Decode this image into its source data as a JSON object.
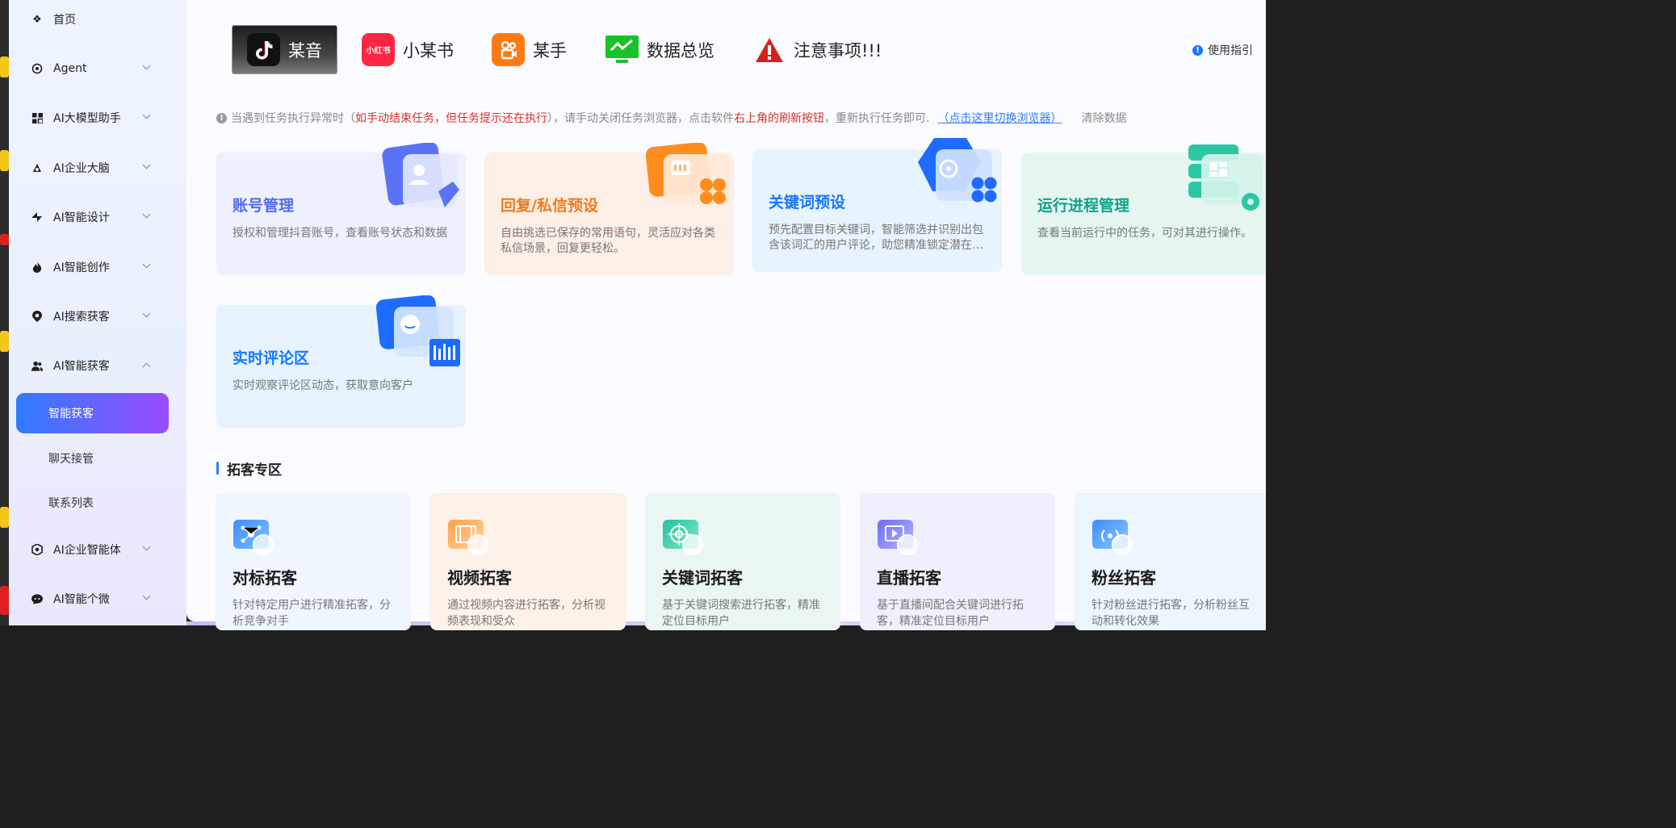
{
  "sidebar": {
    "items": [
      {
        "label": "首页",
        "icon": "home-icon",
        "chevron": "none"
      },
      {
        "label": "Agent",
        "icon": "agent-icon",
        "chevron": "down"
      },
      {
        "label": "AI大模型助手",
        "icon": "grid-icon",
        "chevron": "down"
      },
      {
        "label": "AI企业大脑",
        "icon": "brain-icon",
        "chevron": "down"
      },
      {
        "label": "AI智能设计",
        "icon": "design-icon",
        "chevron": "down"
      },
      {
        "label": "AI智能创作",
        "icon": "flame-icon",
        "chevron": "down"
      },
      {
        "label": "AI搜索获客",
        "icon": "location-icon",
        "chevron": "down"
      },
      {
        "label": "AI智能获客",
        "icon": "users-icon",
        "chevron": "up"
      }
    ],
    "sub_items": [
      {
        "label": "智能获客",
        "active": true
      },
      {
        "label": "聊天接管",
        "active": false
      },
      {
        "label": "联系列表",
        "active": false
      }
    ],
    "items_after": [
      {
        "label": "AI企业智能体",
        "icon": "robot-icon",
        "chevron": "down"
      },
      {
        "label": "AI智能个微",
        "icon": "chat-icon",
        "chevron": "down"
      }
    ]
  },
  "platform_tabs": [
    {
      "label": "某音",
      "icon": "douyin-logo-icon",
      "active": true
    },
    {
      "label": "小某书",
      "icon": "xiaohongshu-logo-icon",
      "logo_text": "小红书",
      "active": false
    },
    {
      "label": "某手",
      "icon": "kuaishou-logo-icon",
      "active": false
    },
    {
      "label": "数据总览",
      "icon": "monitor-chart-icon",
      "active": false
    },
    {
      "label": "注意事项!!!",
      "icon": "warning-icon",
      "active": false
    }
  ],
  "guide": {
    "label": "使用指引"
  },
  "notice": {
    "prefix": "当遇到任务执行异常时（",
    "red1": "如手动结束任务，但任务提示还在执行",
    "mid": "），请手动关闭任务浏览器，点击软件",
    "red2": "右上角的刷新按钮",
    "suffix": "，重新执行任务即可.",
    "link": "（点击这里切换浏览器）",
    "clear": "清除数据"
  },
  "feature_cards": [
    {
      "title": "账号管理",
      "desc": "授权和管理抖音账号，查看账号状态和数据",
      "color": "#4f6cf0"
    },
    {
      "title": "回复/私信预设",
      "desc": "自由挑选已保存的常用语句，灵活应对各类私信场景，回复更轻松。",
      "color": "#f07a1e"
    },
    {
      "title": "关键词预设",
      "desc": "预先配置目标关键词，智能筛选并识别出包含该词汇的用户评论，助您精准锁定潜在…",
      "color": "#1677ff"
    },
    {
      "title": "运行进程管理",
      "desc": "查看当前运行中的任务，可对其进行操作。",
      "color": "#15a08a"
    },
    {
      "title": "实时评论区",
      "desc": "实时观察评论区动态，获取意向客户",
      "color": "#1677ff"
    }
  ],
  "section": {
    "title": "拓客专区"
  },
  "section_cards": [
    {
      "title": "对标拓客",
      "desc": "针对特定用户进行精准拓客，分析竞争对手",
      "icon": "network-icon"
    },
    {
      "title": "视频拓客",
      "desc": "通过视频内容进行拓客，分析视频表现和受众",
      "icon": "film-icon"
    },
    {
      "title": "关键词拓客",
      "desc": "基于关键词搜索进行拓客，精准定位目标用户",
      "icon": "target-icon"
    },
    {
      "title": "直播拓客",
      "desc": "基于直播间配合关键词进行拓客，精准定位目标用户",
      "icon": "live-icon"
    },
    {
      "title": "粉丝拓客",
      "desc": "针对粉丝进行拓客，分析粉丝互动和转化效果",
      "icon": "broadcast-icon"
    }
  ]
}
